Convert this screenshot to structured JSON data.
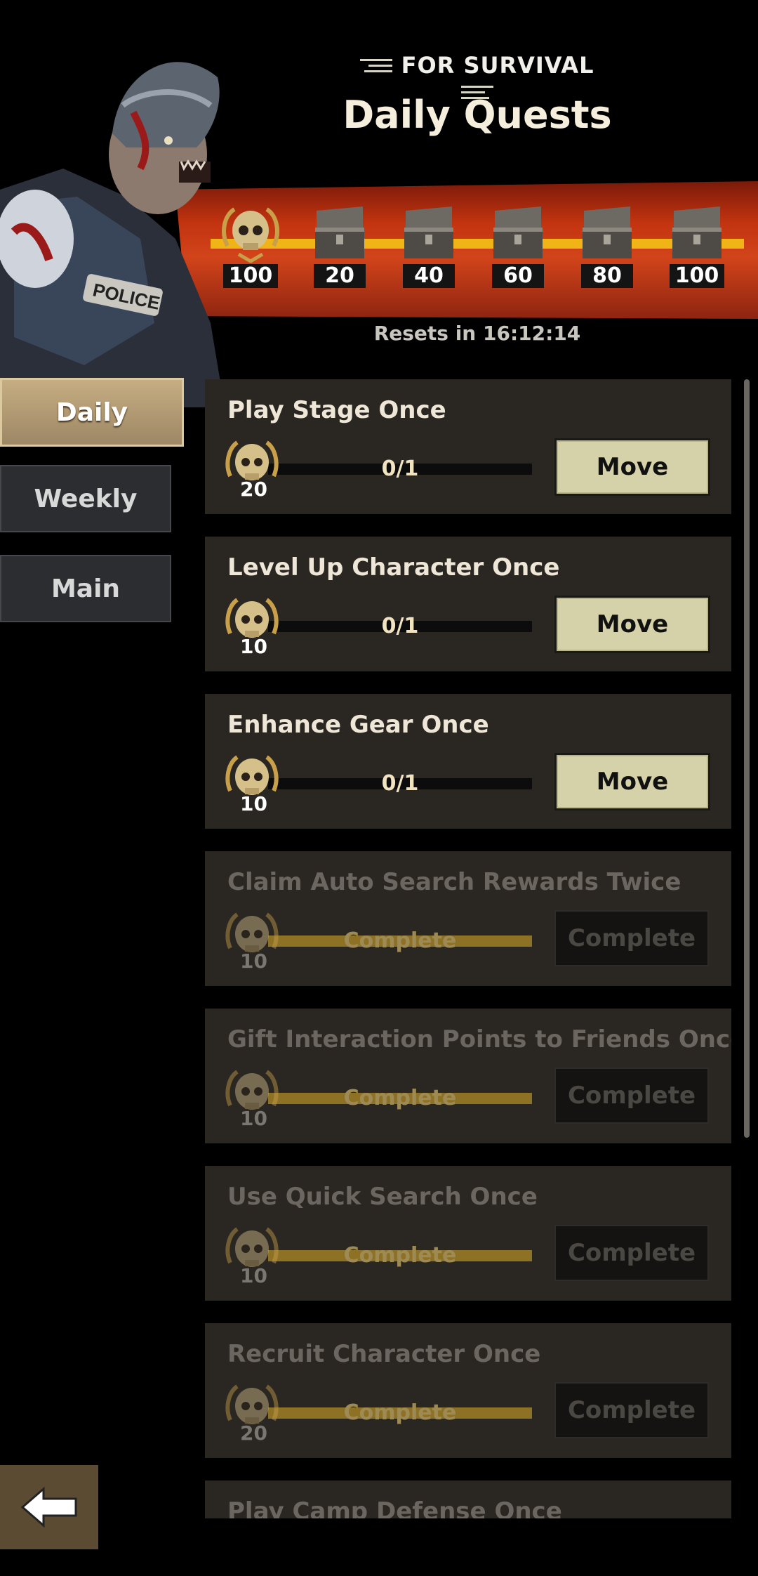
{
  "header": {
    "subtitle": "FOR SURVIVAL",
    "title": "Daily Quests"
  },
  "rewards": {
    "milestones": [
      {
        "icon": "skull-medal-icon",
        "value": "100"
      },
      {
        "icon": "chest-icon",
        "value": "20"
      },
      {
        "icon": "chest-icon",
        "value": "40"
      },
      {
        "icon": "chest-icon",
        "value": "60"
      },
      {
        "icon": "chest-icon",
        "value": "80"
      },
      {
        "icon": "chest-icon",
        "value": "100"
      }
    ],
    "resets": "Resets in 16:12:14"
  },
  "tabs": [
    {
      "label": "Daily",
      "active": true
    },
    {
      "label": "Weekly",
      "active": false
    },
    {
      "label": "Main",
      "active": false
    }
  ],
  "quests": [
    {
      "title": "Play Stage Once",
      "reward": "20",
      "progress_label": "0/1",
      "progress": 0,
      "button": "Move",
      "completed": false
    },
    {
      "title": "Level Up Character Once",
      "reward": "10",
      "progress_label": "0/1",
      "progress": 0,
      "button": "Move",
      "completed": false
    },
    {
      "title": "Enhance Gear Once",
      "reward": "10",
      "progress_label": "0/1",
      "progress": 0,
      "button": "Move",
      "completed": false
    },
    {
      "title": "Claim Auto Search Rewards Twice",
      "reward": "10",
      "progress_label": "Complete",
      "progress": 1,
      "button": "Complete",
      "completed": true
    },
    {
      "title": "Gift Interaction Points to Friends Once",
      "reward": "10",
      "progress_label": "Complete",
      "progress": 1,
      "button": "Complete",
      "completed": true
    },
    {
      "title": "Use Quick Search Once",
      "reward": "10",
      "progress_label": "Complete",
      "progress": 1,
      "button": "Complete",
      "completed": true
    },
    {
      "title": "Recruit Character Once",
      "reward": "20",
      "progress_label": "Complete",
      "progress": 1,
      "button": "Complete",
      "completed": true
    },
    {
      "title": "Play Camp Defense Once",
      "reward": "",
      "progress_label": "",
      "progress": 0,
      "button": "",
      "completed": false
    }
  ],
  "colors": {
    "accent": "#f0b416",
    "banner": "#c2330f",
    "button": "#d5d1a9"
  }
}
